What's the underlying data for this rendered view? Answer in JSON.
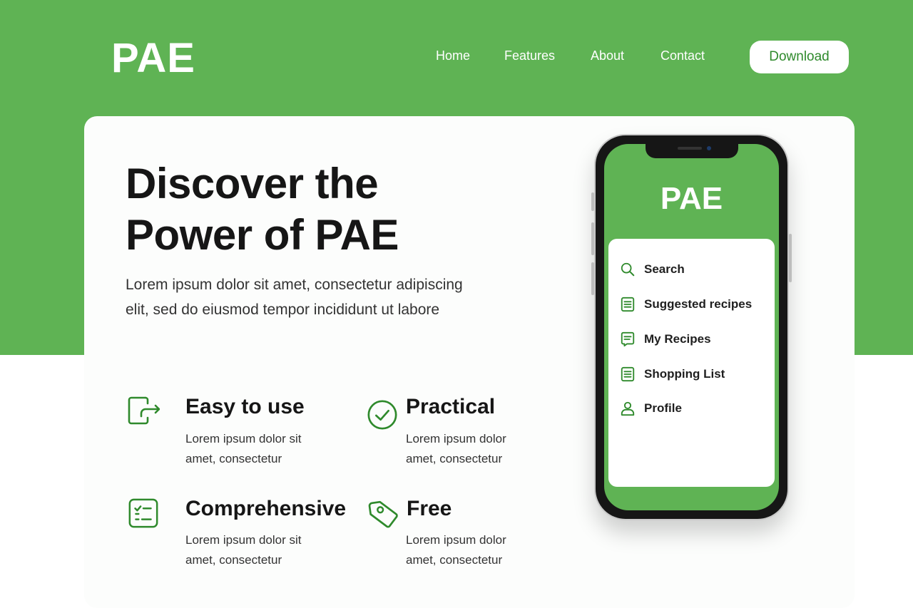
{
  "brand": {
    "logo": "PAE",
    "accent_color": "#5fb354",
    "icon_color": "#2f8a2c"
  },
  "nav": {
    "items": [
      {
        "label": "Home"
      },
      {
        "label": "Features"
      },
      {
        "label": "About"
      },
      {
        "label": "Contact"
      }
    ],
    "download_label": "Download"
  },
  "hero": {
    "title_line1": "Discover the",
    "title_line2": "Power of PAE",
    "subtitle_line1": "Lorem ipsum dolor sit amet, consectetur adipiscing",
    "subtitle_line2": "elit, sed do eiusmod tempor incididunt ut labore"
  },
  "features": [
    {
      "icon": "exit-door-icon",
      "title": "Easy to use",
      "desc_line1": "Lorem ipsum dolor sit",
      "desc_line2": "amet, consectetur"
    },
    {
      "icon": "check-circle-icon",
      "title": "Practical",
      "desc_line1": "Lorem ipsum dolor",
      "desc_line2": "amet, consectetur"
    },
    {
      "icon": "checklist-icon",
      "title": "Comprehensive",
      "desc_line1": "Lorem ipsum dolor sit",
      "desc_line2": "amet, consectetur"
    },
    {
      "icon": "tag-icon",
      "title": "Free",
      "desc_line1": "Lorem ipsum dolor",
      "desc_line2": "amet, consectetur"
    }
  ],
  "phone": {
    "logo": "PAE",
    "menu": [
      {
        "icon": "search-icon",
        "label": "Search"
      },
      {
        "icon": "document-icon",
        "label": "Suggested recipes"
      },
      {
        "icon": "message-document-icon",
        "label": "My Recipes"
      },
      {
        "icon": "list-icon",
        "label": "Shopping List"
      },
      {
        "icon": "user-icon",
        "label": "Profile"
      }
    ]
  }
}
